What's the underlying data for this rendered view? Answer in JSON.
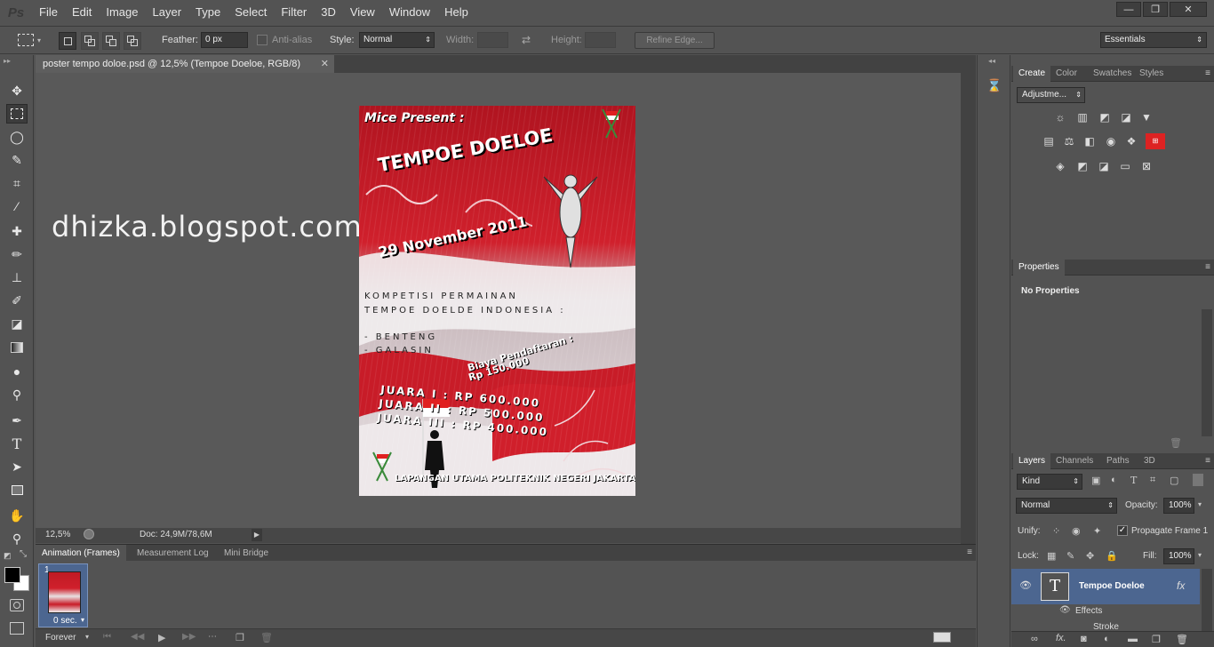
{
  "app": {
    "logo": "Ps",
    "window_controls": [
      "—",
      "❐",
      "✕"
    ]
  },
  "menu": [
    "File",
    "Edit",
    "Image",
    "Layer",
    "Type",
    "Select",
    "Filter",
    "3D",
    "View",
    "Window",
    "Help"
  ],
  "options_bar": {
    "feather_label": "Feather:",
    "feather_value": "0 px",
    "antialias_label": "Anti-alias",
    "style_label": "Style:",
    "style_value": "Normal",
    "width_label": "Width:",
    "height_label": "Height:",
    "refine_edge_label": "Refine Edge...",
    "workspace_value": "Essentials"
  },
  "document": {
    "tab_title": "poster tempo doloe.psd @ 12,5% (Tempoe Doeloe, RGB/8)",
    "zoom": "12,5%",
    "doc_size": "Doc: 24,9M/78,6M"
  },
  "watermark_text": "dhizka.blogspot.com",
  "poster": {
    "presenter": "Mice Present :",
    "title": "TEMPOE DOELOE",
    "date": "29 November 2011",
    "competition_line1": "KOMPETISI PERMAINAN",
    "competition_line2": "TEMPOE DOELDE INDONESIA :",
    "item1": "- BENTENG",
    "item2": "- GALASIN",
    "fee_label": "Biaya Pendaftaran :",
    "fee_value": "Rp 150.000",
    "prize1": "JUARA I : RP 600.000",
    "prize2": "JUARA II : RP 500.000",
    "prize3": "JUARA III : RP 400.000",
    "venue": "LAPANGAN UTAMA POLITEKNIK NEGERI JAKARTA"
  },
  "animation_panel": {
    "tabs": [
      "Animation (Frames)",
      "Measurement Log",
      "Mini Bridge"
    ],
    "frame_number": "1",
    "frame_delay": "0 sec.",
    "loop": "Forever"
  },
  "adjustments_panel": {
    "tabs": [
      "Create",
      "Color",
      "Swatches",
      "Styles"
    ],
    "dropdown": "Adjustme..."
  },
  "properties_panel": {
    "title": "Properties",
    "content": "No Properties"
  },
  "layers_panel": {
    "tabs": [
      "Layers",
      "Channels",
      "Paths",
      "3D"
    ],
    "filter_kind": "Kind",
    "blend_mode": "Normal",
    "opacity_label": "Opacity:",
    "opacity_value": "100%",
    "unify_label": "Unify:",
    "propagate_label": "Propagate Frame 1",
    "lock_label": "Lock:",
    "fill_label": "Fill:",
    "fill_value": "100%",
    "layer_name": "Tempoe Doeloe",
    "effects_label": "Effects",
    "stroke_label": "Stroke",
    "fx_label": "fx"
  },
  "colors": {
    "poster_red": "#c01a24",
    "accent_blue": "#4c6690"
  }
}
